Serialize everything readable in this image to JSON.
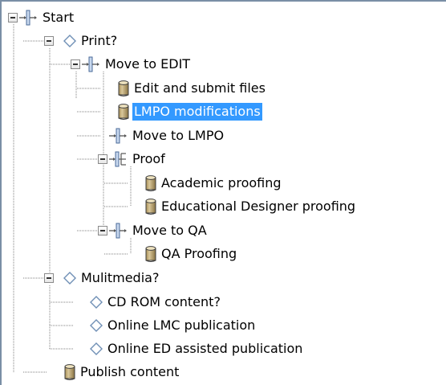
{
  "tree": {
    "nodes": [
      {
        "id": "start",
        "label": "Start",
        "icon": "task-step-icon",
        "expanded": true
      },
      {
        "id": "print",
        "label": "Print?",
        "icon": "decision-diamond-icon",
        "expanded": true
      },
      {
        "id": "move-to-edit",
        "label": "Move to EDIT",
        "icon": "task-step-icon",
        "expanded": true
      },
      {
        "id": "edit-submit",
        "label": "Edit and submit files",
        "icon": "cylinder-icon"
      },
      {
        "id": "lmpo-mod",
        "label": "LMPO modifications",
        "icon": "cylinder-icon",
        "selected": true
      },
      {
        "id": "move-to-lmpo",
        "label": "Move to LMPO",
        "icon": "task-step-icon"
      },
      {
        "id": "proof",
        "label": "Proof",
        "icon": "parallel-step-icon",
        "expanded": true
      },
      {
        "id": "academic-proofing",
        "label": "Academic proofing",
        "icon": "cylinder-icon"
      },
      {
        "id": "ed-designer-proofing",
        "label": "Educational Designer proofing",
        "icon": "cylinder-icon"
      },
      {
        "id": "move-to-qa",
        "label": "Move to QA",
        "icon": "task-step-icon",
        "expanded": true
      },
      {
        "id": "qa-proofing",
        "label": "QA Proofing",
        "icon": "cylinder-icon"
      },
      {
        "id": "multimedia",
        "label": "Mulitmedia?",
        "icon": "decision-diamond-icon",
        "expanded": true
      },
      {
        "id": "cd-rom",
        "label": "CD ROM content?",
        "icon": "decision-diamond-icon"
      },
      {
        "id": "online-lmc",
        "label": "Online LMC publication",
        "icon": "decision-diamond-icon"
      },
      {
        "id": "online-ed",
        "label": "Online ED assisted publication",
        "icon": "decision-diamond-icon"
      },
      {
        "id": "publish",
        "label": "Publish content",
        "icon": "cylinder-icon"
      }
    ]
  },
  "colors": {
    "selection_bg": "#3399ff",
    "selection_text": "#ffffff",
    "diamond_stroke": "#6f8fb5",
    "cylinder_fill": "#d9c79a"
  }
}
